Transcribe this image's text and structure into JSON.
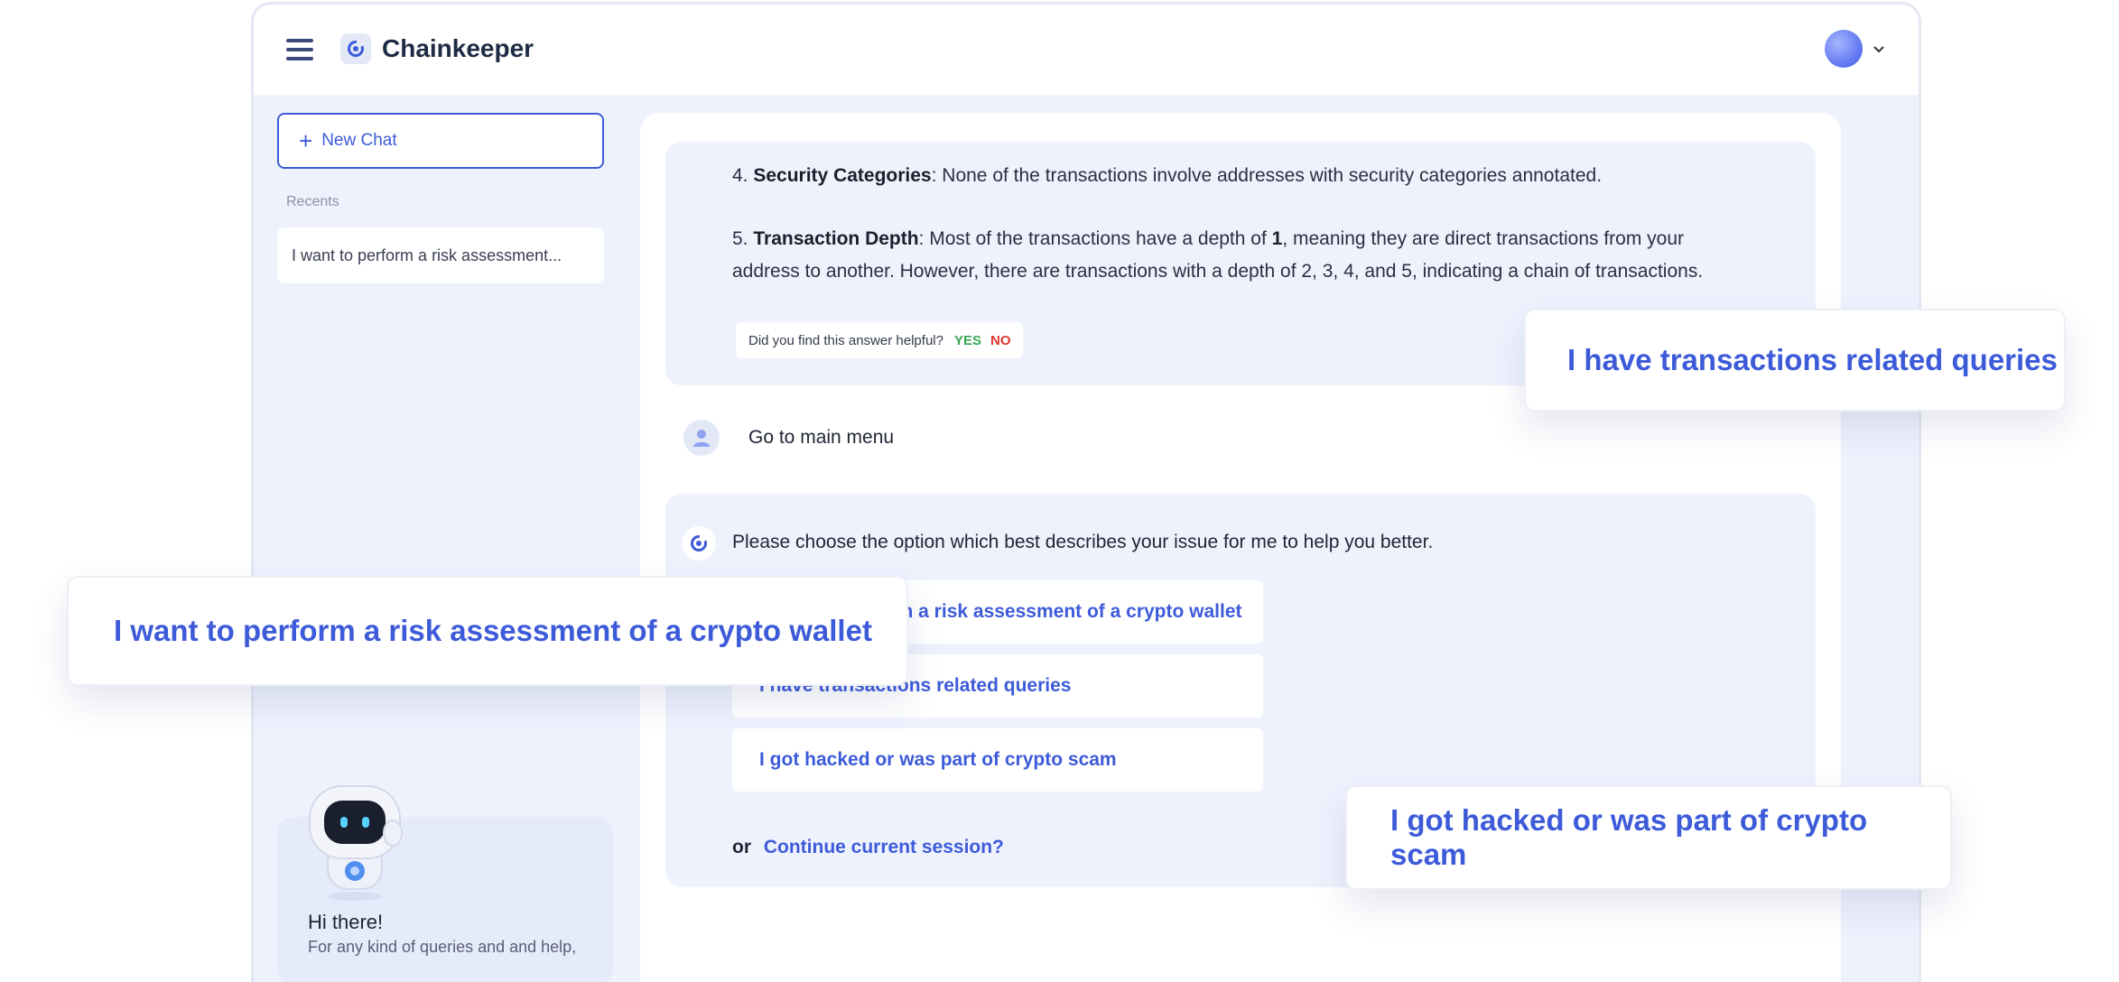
{
  "header": {
    "brand_name": "Chainkeeper",
    "icons": {
      "menu": "hamburger-menu-icon",
      "logo": "chainkeeper-logo-icon",
      "avatar": "user-avatar",
      "dropdown": "chevron-down-icon"
    }
  },
  "sidebar": {
    "new_chat_label": "New Chat",
    "recents_label": "Recents",
    "recents": [
      {
        "label": "I want to perform a risk assessment..."
      }
    ],
    "help_card": {
      "title": "Hi there!",
      "subtitle": "For any kind of queries and and help,"
    }
  },
  "chat": {
    "bot_message_1": {
      "item4": {
        "number": "4.",
        "title": "Security Categories",
        "text": ": None of the transactions involve addresses with security categories annotated."
      },
      "item5": {
        "number": "5.",
        "title": "Transaction Depth",
        "text_before": ": Most of the transactions have a depth of",
        "value": "1",
        "text_line1_after": ", meaning they are direct transactions from your",
        "text_line2": "address to another. However, there are transactions with a depth of 2, 3, 4, and 5, indicating a chain of transactions."
      },
      "feedback": {
        "question": "Did you find this answer helpful?",
        "yes": "YES",
        "no": "NO"
      }
    },
    "user_message": "Go to main menu",
    "bot_message_2": {
      "prompt": "Please choose the option which best describes your issue for me to help you better.",
      "options": [
        {
          "label": "I want to perform a risk assessment of a crypto wallet"
        },
        {
          "label": "I have transactions related queries"
        },
        {
          "label": "I got hacked or was part of crypto scam"
        }
      ],
      "continue_prefix": "or",
      "continue_link": "Continue current session?"
    }
  },
  "callouts": [
    {
      "label": "I have transactions related queries"
    },
    {
      "label": "I want to perform a risk assessment of a crypto wallet"
    },
    {
      "label": "I got hacked or was part of crypto scam"
    }
  ],
  "colors": {
    "accent": "#3d5bd9",
    "panel_bg": "#eef2fd",
    "yes": "#3aa757",
    "no": "#e0352f"
  }
}
